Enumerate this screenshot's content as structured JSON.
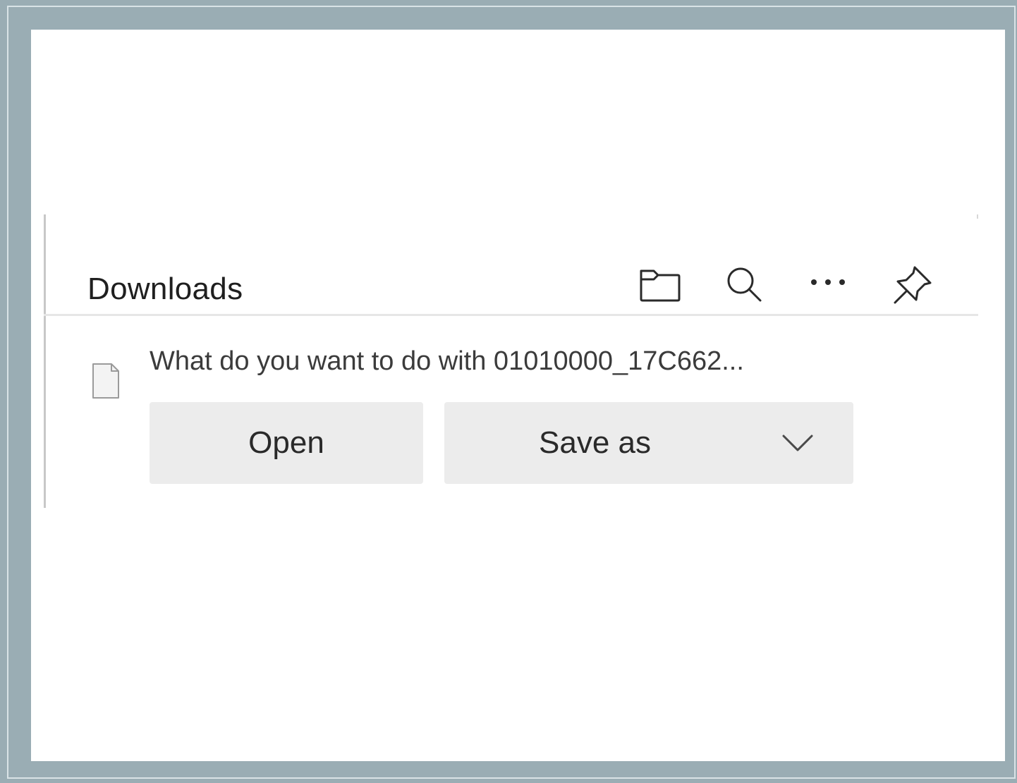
{
  "downloads_panel": {
    "title": "Downloads",
    "header_actions": [
      {
        "name": "open-downloads-folder",
        "icon": "folder-icon"
      },
      {
        "name": "search-downloads",
        "icon": "search-icon"
      },
      {
        "name": "more-options",
        "icon": "more-horizontal-icon"
      },
      {
        "name": "pin-downloads",
        "icon": "pin-icon"
      }
    ],
    "pending_item": {
      "file_icon": "file-icon",
      "prompt": "What do you want to do with 01010000_17C662...",
      "open_label": "Open",
      "save_as_label": "Save as",
      "save_as_menu_icon": "chevron-down-icon"
    }
  },
  "colors": {
    "frame": "#9aadb4",
    "button_bg": "#ececec",
    "text": "#1f1f1f"
  }
}
